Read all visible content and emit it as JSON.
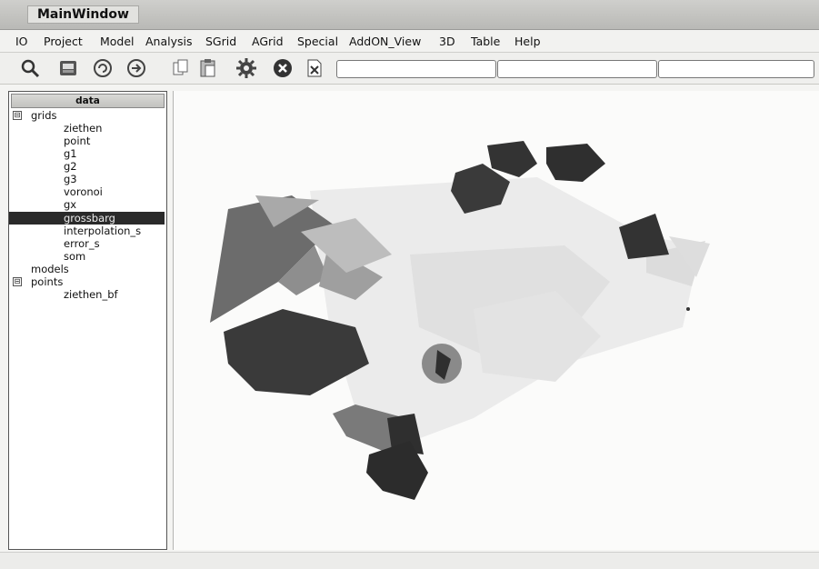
{
  "window": {
    "title": "MainWindow"
  },
  "menu": [
    "IO",
    "Project",
    "Model",
    "Analysis",
    "SGrid",
    "AGrid",
    "Special",
    "AddON_View",
    "3D",
    "Table",
    "Help"
  ],
  "toolbar": {
    "icons": [
      "zoom-icon",
      "view-icon",
      "refresh-icon",
      "forward-icon",
      "copy-icon",
      "paste-icon",
      "settings-gear-icon",
      "stop-icon",
      "close-document-icon"
    ],
    "fields": [
      "",
      "",
      ""
    ]
  },
  "panel": {
    "title": "data",
    "tree": [
      {
        "label": "grids",
        "toggle": "⊟"
      },
      {
        "label": "ziethen"
      },
      {
        "label": "point"
      },
      {
        "label": "g1"
      },
      {
        "label": "g2"
      },
      {
        "label": "g3"
      },
      {
        "label": "voronoi"
      },
      {
        "label": "gx"
      },
      {
        "label": "grossbarg",
        "selected": true
      },
      {
        "label": "interpolation_s"
      },
      {
        "label": "error_s"
      },
      {
        "label": "som"
      },
      {
        "label": "models"
      },
      {
        "label": "points",
        "toggle": "⊟"
      },
      {
        "label": "ziethen_bf"
      }
    ]
  },
  "colors": {
    "dark": "#2f2f2f",
    "mid": "#6c6c6c",
    "light": "#cfcfcf",
    "pale": "#e6e6e6"
  }
}
